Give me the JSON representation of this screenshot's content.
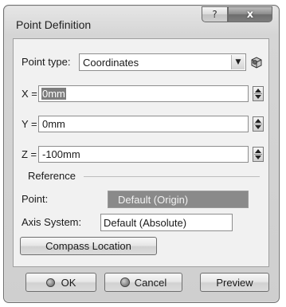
{
  "window": {
    "title": "Point Definition",
    "help_glyph": "?",
    "close_glyph": "x"
  },
  "point_type": {
    "label": "Point type:",
    "value": "Coordinates"
  },
  "coordinates": {
    "x_label": "X =",
    "x_value": "0mm",
    "y_label": "Y =",
    "y_value": "0mm",
    "z_label": "Z =",
    "z_value": "-100mm"
  },
  "reference": {
    "group_label": "Reference",
    "point_label": "Point:",
    "point_value": "Default (Origin)",
    "axis_label": "Axis System:",
    "axis_value": "Default (Absolute)"
  },
  "buttons": {
    "compass": "Compass Location",
    "ok": "OK",
    "cancel": "Cancel",
    "preview": "Preview"
  },
  "icons": {
    "dropdown": "chevron-down-icon",
    "entity": "3d-entity-icon",
    "ok": "green-dot-icon",
    "cancel": "red-dot-icon"
  }
}
